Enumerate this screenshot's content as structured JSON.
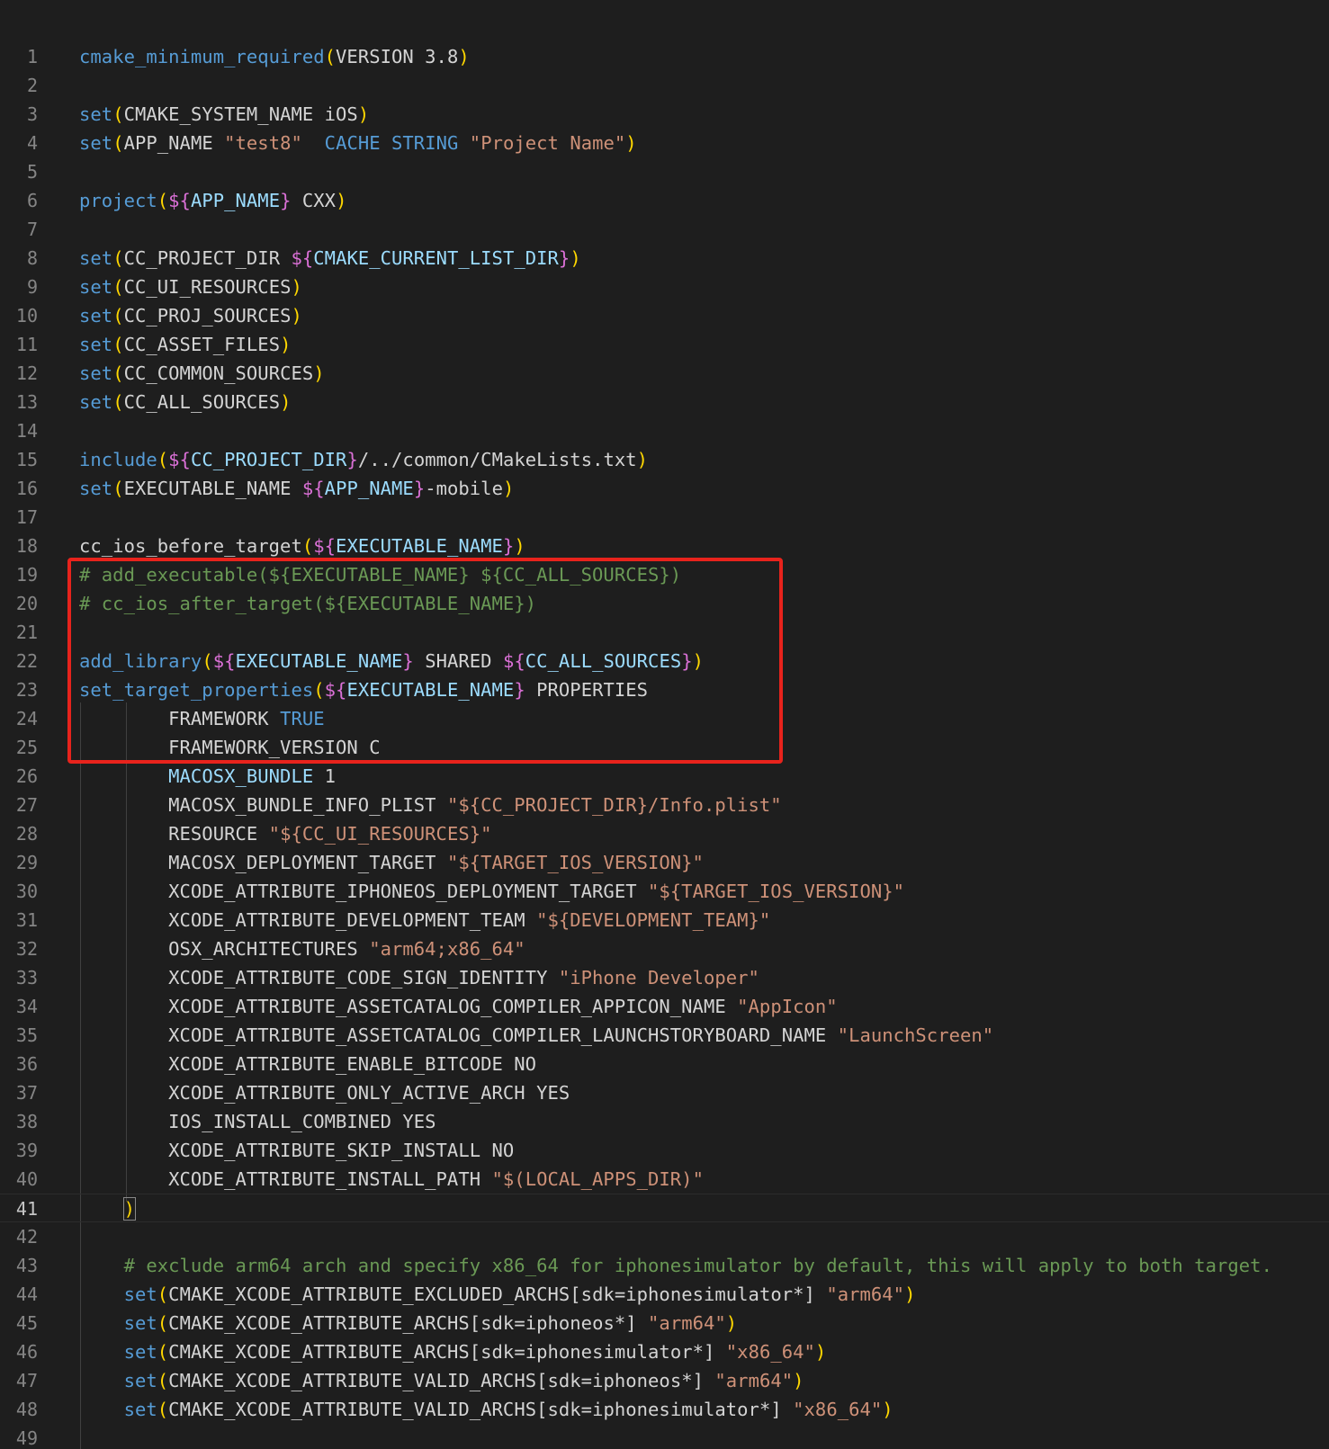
{
  "editor": {
    "language": "cmake",
    "current_line": 41,
    "highlight_color": "#e8231c",
    "colors": {
      "background": "#1e1e1e",
      "keyword": "#569cd6",
      "variable": "#9cdcfe",
      "paren": "#ffd700",
      "brace": "#da70d6",
      "string": "#ce9178",
      "comment": "#6a9955",
      "text": "#d4d4d4"
    },
    "lines": [
      {
        "n": 1,
        "t": [
          [
            "fn",
            "cmake_minimum_required"
          ],
          [
            "par",
            "("
          ],
          [
            "txt",
            "VERSION 3.8"
          ],
          [
            "par",
            ")"
          ]
        ]
      },
      {
        "n": 2,
        "t": []
      },
      {
        "n": 3,
        "t": [
          [
            "fn",
            "set"
          ],
          [
            "par",
            "("
          ],
          [
            "txt",
            "CMAKE_SYSTEM_NAME iOS"
          ],
          [
            "par",
            ")"
          ]
        ]
      },
      {
        "n": 4,
        "t": [
          [
            "fn",
            "set"
          ],
          [
            "par",
            "("
          ],
          [
            "txt",
            "APP_NAME "
          ],
          [
            "str",
            "\"test8\""
          ],
          [
            "txt",
            "  "
          ],
          [
            "fn",
            "CACHE STRING"
          ],
          [
            "txt",
            " "
          ],
          [
            "str",
            "\"Project Name\""
          ],
          [
            "par",
            ")"
          ]
        ]
      },
      {
        "n": 5,
        "t": []
      },
      {
        "n": 6,
        "t": [
          [
            "fn",
            "project"
          ],
          [
            "par",
            "("
          ],
          [
            "br",
            "${"
          ],
          [
            "var",
            "APP_NAME"
          ],
          [
            "br",
            "}"
          ],
          [
            "txt",
            " CXX"
          ],
          [
            "par",
            ")"
          ]
        ]
      },
      {
        "n": 7,
        "t": []
      },
      {
        "n": 8,
        "t": [
          [
            "fn",
            "set"
          ],
          [
            "par",
            "("
          ],
          [
            "txt",
            "CC_PROJECT_DIR "
          ],
          [
            "br",
            "${"
          ],
          [
            "var",
            "CMAKE_CURRENT_LIST_DIR"
          ],
          [
            "br",
            "}"
          ],
          [
            "par",
            ")"
          ]
        ]
      },
      {
        "n": 9,
        "t": [
          [
            "fn",
            "set"
          ],
          [
            "par",
            "("
          ],
          [
            "txt",
            "CC_UI_RESOURCES"
          ],
          [
            "par",
            ")"
          ]
        ]
      },
      {
        "n": 10,
        "t": [
          [
            "fn",
            "set"
          ],
          [
            "par",
            "("
          ],
          [
            "txt",
            "CC_PROJ_SOURCES"
          ],
          [
            "par",
            ")"
          ]
        ]
      },
      {
        "n": 11,
        "t": [
          [
            "fn",
            "set"
          ],
          [
            "par",
            "("
          ],
          [
            "txt",
            "CC_ASSET_FILES"
          ],
          [
            "par",
            ")"
          ]
        ]
      },
      {
        "n": 12,
        "t": [
          [
            "fn",
            "set"
          ],
          [
            "par",
            "("
          ],
          [
            "txt",
            "CC_COMMON_SOURCES"
          ],
          [
            "par",
            ")"
          ]
        ]
      },
      {
        "n": 13,
        "t": [
          [
            "fn",
            "set"
          ],
          [
            "par",
            "("
          ],
          [
            "txt",
            "CC_ALL_SOURCES"
          ],
          [
            "par",
            ")"
          ]
        ]
      },
      {
        "n": 14,
        "t": []
      },
      {
        "n": 15,
        "t": [
          [
            "fn",
            "include"
          ],
          [
            "par",
            "("
          ],
          [
            "br",
            "${"
          ],
          [
            "var",
            "CC_PROJECT_DIR"
          ],
          [
            "br",
            "}"
          ],
          [
            "txt",
            "/../common/CMakeLists.txt"
          ],
          [
            "par",
            ")"
          ]
        ]
      },
      {
        "n": 16,
        "t": [
          [
            "fn",
            "set"
          ],
          [
            "par",
            "("
          ],
          [
            "txt",
            "EXECUTABLE_NAME "
          ],
          [
            "br",
            "${"
          ],
          [
            "var",
            "APP_NAME"
          ],
          [
            "br",
            "}"
          ],
          [
            "txt",
            "-mobile"
          ],
          [
            "par",
            ")"
          ]
        ]
      },
      {
        "n": 17,
        "t": []
      },
      {
        "n": 18,
        "t": [
          [
            "txt",
            "cc_ios_before_target"
          ],
          [
            "par",
            "("
          ],
          [
            "br",
            "${"
          ],
          [
            "var",
            "EXECUTABLE_NAME"
          ],
          [
            "br",
            "}"
          ],
          [
            "par",
            ")"
          ]
        ]
      },
      {
        "n": 19,
        "t": [
          [
            "cm",
            "# add_executable(${EXECUTABLE_NAME} ${CC_ALL_SOURCES})"
          ]
        ]
      },
      {
        "n": 20,
        "t": [
          [
            "cm",
            "# cc_ios_after_target(${EXECUTABLE_NAME})"
          ]
        ]
      },
      {
        "n": 21,
        "t": []
      },
      {
        "n": 22,
        "t": [
          [
            "fn",
            "add_library"
          ],
          [
            "par",
            "("
          ],
          [
            "br",
            "${"
          ],
          [
            "var",
            "EXECUTABLE_NAME"
          ],
          [
            "br",
            "}"
          ],
          [
            "txt",
            " SHARED "
          ],
          [
            "br",
            "${"
          ],
          [
            "var",
            "CC_ALL_SOURCES"
          ],
          [
            "br",
            "}"
          ],
          [
            "par",
            ")"
          ]
        ]
      },
      {
        "n": 23,
        "t": [
          [
            "fn",
            "set_target_properties"
          ],
          [
            "par",
            "("
          ],
          [
            "br",
            "${"
          ],
          [
            "var",
            "EXECUTABLE_NAME"
          ],
          [
            "br",
            "}"
          ],
          [
            "txt",
            " PROPERTIES"
          ]
        ]
      },
      {
        "n": 24,
        "t": [
          [
            "txt",
            "        FRAMEWORK "
          ],
          [
            "fn",
            "TRUE"
          ]
        ]
      },
      {
        "n": 25,
        "t": [
          [
            "txt",
            "        FRAMEWORK_VERSION C"
          ]
        ]
      },
      {
        "n": 26,
        "t": [
          [
            "txt",
            "        "
          ],
          [
            "var",
            "MACOSX_BUNDLE"
          ],
          [
            "txt",
            " 1"
          ]
        ]
      },
      {
        "n": 27,
        "t": [
          [
            "txt",
            "        MACOSX_BUNDLE_INFO_PLIST "
          ],
          [
            "str",
            "\"${CC_PROJECT_DIR}/Info.plist\""
          ]
        ]
      },
      {
        "n": 28,
        "t": [
          [
            "txt",
            "        RESOURCE "
          ],
          [
            "str",
            "\"${CC_UI_RESOURCES}\""
          ]
        ]
      },
      {
        "n": 29,
        "t": [
          [
            "txt",
            "        MACOSX_DEPLOYMENT_TARGET "
          ],
          [
            "str",
            "\"${TARGET_IOS_VERSION}\""
          ]
        ]
      },
      {
        "n": 30,
        "t": [
          [
            "txt",
            "        XCODE_ATTRIBUTE_IPHONEOS_DEPLOYMENT_TARGET "
          ],
          [
            "str",
            "\"${TARGET_IOS_VERSION}\""
          ]
        ]
      },
      {
        "n": 31,
        "t": [
          [
            "txt",
            "        XCODE_ATTRIBUTE_DEVELOPMENT_TEAM "
          ],
          [
            "str",
            "\"${DEVELOPMENT_TEAM}\""
          ]
        ]
      },
      {
        "n": 32,
        "t": [
          [
            "txt",
            "        OSX_ARCHITECTURES "
          ],
          [
            "str",
            "\"arm64;x86_64\""
          ]
        ]
      },
      {
        "n": 33,
        "t": [
          [
            "txt",
            "        XCODE_ATTRIBUTE_CODE_SIGN_IDENTITY "
          ],
          [
            "str",
            "\"iPhone Developer\""
          ]
        ]
      },
      {
        "n": 34,
        "t": [
          [
            "txt",
            "        XCODE_ATTRIBUTE_ASSETCATALOG_COMPILER_APPICON_NAME "
          ],
          [
            "str",
            "\"AppIcon\""
          ]
        ]
      },
      {
        "n": 35,
        "t": [
          [
            "txt",
            "        XCODE_ATTRIBUTE_ASSETCATALOG_COMPILER_LAUNCHSTORYBOARD_NAME "
          ],
          [
            "str",
            "\"LaunchScreen\""
          ]
        ]
      },
      {
        "n": 36,
        "t": [
          [
            "txt",
            "        XCODE_ATTRIBUTE_ENABLE_BITCODE NO"
          ]
        ]
      },
      {
        "n": 37,
        "t": [
          [
            "txt",
            "        XCODE_ATTRIBUTE_ONLY_ACTIVE_ARCH YES"
          ]
        ]
      },
      {
        "n": 38,
        "t": [
          [
            "txt",
            "        IOS_INSTALL_COMBINED YES"
          ]
        ]
      },
      {
        "n": 39,
        "t": [
          [
            "txt",
            "        XCODE_ATTRIBUTE_SKIP_INSTALL NO"
          ]
        ]
      },
      {
        "n": 40,
        "t": [
          [
            "txt",
            "        XCODE_ATTRIBUTE_INSTALL_PATH "
          ],
          [
            "str",
            "\"$(LOCAL_APPS_DIR)\""
          ]
        ]
      },
      {
        "n": 41,
        "t": [
          [
            "txt",
            "    "
          ],
          [
            "par",
            ")"
          ]
        ]
      },
      {
        "n": 42,
        "t": []
      },
      {
        "n": 43,
        "t": [
          [
            "txt",
            "    "
          ],
          [
            "cm",
            "# exclude arm64 arch and specify x86_64 for iphonesimulator by default, this will apply to both target."
          ]
        ]
      },
      {
        "n": 44,
        "t": [
          [
            "txt",
            "    "
          ],
          [
            "fn",
            "set"
          ],
          [
            "par",
            "("
          ],
          [
            "txt",
            "CMAKE_XCODE_ATTRIBUTE_EXCLUDED_ARCHS[sdk=iphonesimulator*] "
          ],
          [
            "str",
            "\"arm64\""
          ],
          [
            "par",
            ")"
          ]
        ]
      },
      {
        "n": 45,
        "t": [
          [
            "txt",
            "    "
          ],
          [
            "fn",
            "set"
          ],
          [
            "par",
            "("
          ],
          [
            "txt",
            "CMAKE_XCODE_ATTRIBUTE_ARCHS[sdk=iphoneos*] "
          ],
          [
            "str",
            "\"arm64\""
          ],
          [
            "par",
            ")"
          ]
        ]
      },
      {
        "n": 46,
        "t": [
          [
            "txt",
            "    "
          ],
          [
            "fn",
            "set"
          ],
          [
            "par",
            "("
          ],
          [
            "txt",
            "CMAKE_XCODE_ATTRIBUTE_ARCHS[sdk=iphonesimulator*] "
          ],
          [
            "str",
            "\"x86_64\""
          ],
          [
            "par",
            ")"
          ]
        ]
      },
      {
        "n": 47,
        "t": [
          [
            "txt",
            "    "
          ],
          [
            "fn",
            "set"
          ],
          [
            "par",
            "("
          ],
          [
            "txt",
            "CMAKE_XCODE_ATTRIBUTE_VALID_ARCHS[sdk=iphoneos*] "
          ],
          [
            "str",
            "\"arm64\""
          ],
          [
            "par",
            ")"
          ]
        ]
      },
      {
        "n": 48,
        "t": [
          [
            "txt",
            "    "
          ],
          [
            "fn",
            "set"
          ],
          [
            "par",
            "("
          ],
          [
            "txt",
            "CMAKE_XCODE_ATTRIBUTE_VALID_ARCHS[sdk=iphonesimulator*] "
          ],
          [
            "str",
            "\"x86_64\""
          ],
          [
            "par",
            ")"
          ]
        ]
      },
      {
        "n": 49,
        "t": []
      }
    ]
  }
}
